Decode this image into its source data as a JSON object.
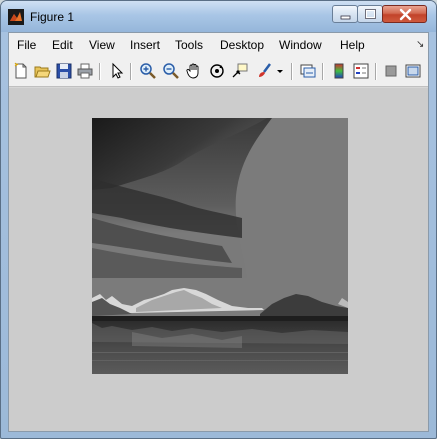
{
  "window": {
    "title": "Figure 1",
    "controls": {
      "minimize": "minimize",
      "maximize": "maximize",
      "close": "close"
    }
  },
  "menu": {
    "items": [
      "File",
      "Edit",
      "View",
      "Insert",
      "Tools",
      "Desktop",
      "Window",
      "Help"
    ]
  },
  "toolbar": {
    "tools": [
      "new-figure-icon",
      "open-file-icon",
      "save-icon",
      "print-icon",
      "edit-plot-arrow-icon",
      "zoom-in-icon",
      "zoom-out-icon",
      "pan-hand-icon",
      "rotate-3d-icon",
      "data-cursor-icon",
      "brush-icon",
      "brush-dropdown-icon",
      "link-plot-icon",
      "insert-colorbar-icon",
      "insert-legend-icon",
      "hide-plot-tools-icon",
      "show-plot-tools-icon"
    ]
  },
  "figure": {
    "image_content": "grayscale photograph of a lake with snow-capped mountains under a cloudy sky"
  }
}
